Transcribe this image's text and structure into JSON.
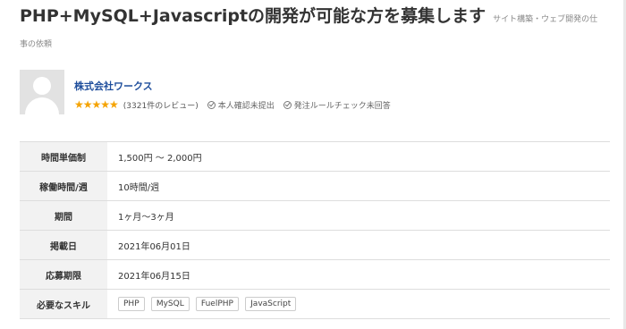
{
  "job": {
    "title": "PHP+MySQL+Javascriptの開発が可能な方を募集します",
    "category_part1": "サイト構築・ウェブ開発の仕",
    "category_part2": "事の依頼"
  },
  "client": {
    "name": "株式会社ワークス",
    "stars": "★★★★★",
    "rating": 5,
    "reviews": "(3321件のレビュー)",
    "identity_check": "本人確認未提出",
    "rule_check": "発注ルールチェック未回答"
  },
  "details": [
    {
      "label": "時間単価制",
      "value": "1,500円 〜 2,000円"
    },
    {
      "label": "稼働時間/週",
      "value": "10時間/週"
    },
    {
      "label": "期間",
      "value": "1ヶ月〜3ヶ月"
    },
    {
      "label": "掲載日",
      "value": "2021年06月01日"
    },
    {
      "label": "応募期限",
      "value": "2021年06月15日"
    }
  ],
  "skills": {
    "label": "必要なスキル",
    "items": [
      "PHP",
      "MySQL",
      "FuelPHP",
      "JavaScript"
    ]
  }
}
